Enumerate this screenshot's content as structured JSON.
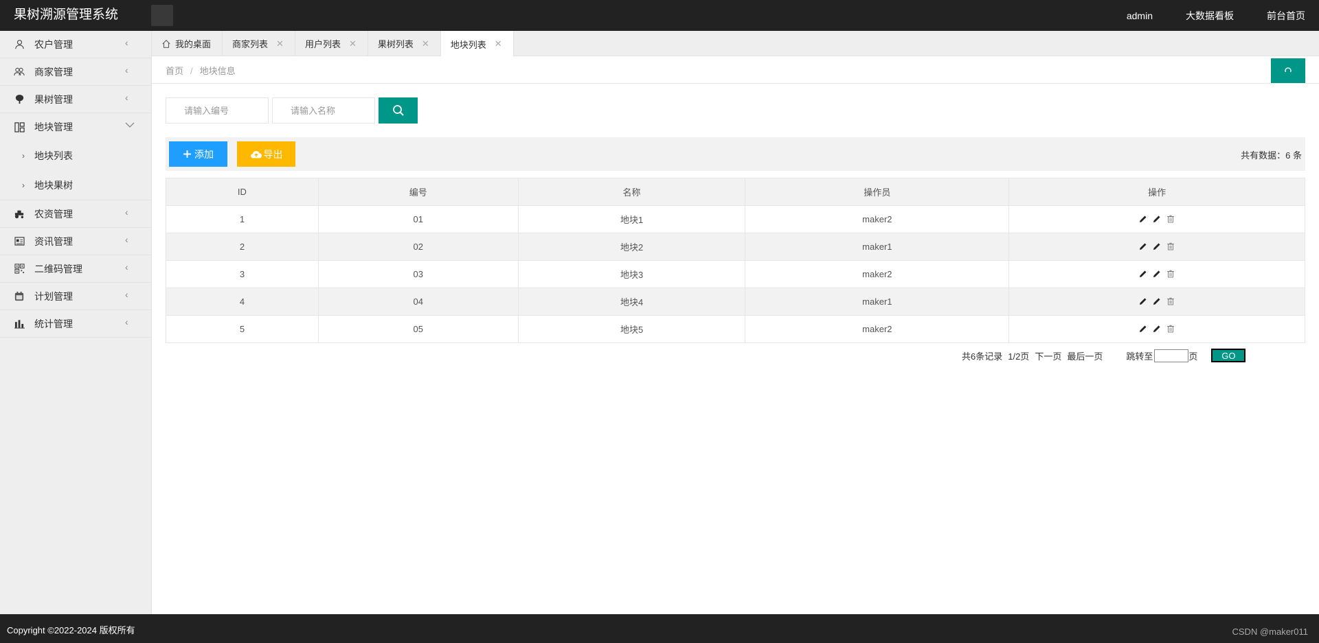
{
  "header": {
    "title": "果树溯源管理系统",
    "nav": [
      "admin",
      "大数据看板",
      "前台首页"
    ]
  },
  "sidebar": {
    "items": [
      {
        "label": "农户管理",
        "icon": "user-icon"
      },
      {
        "label": "商家管理",
        "icon": "users-icon"
      },
      {
        "label": "果树管理",
        "icon": "tree-icon"
      },
      {
        "label": "地块管理",
        "icon": "grid-icon",
        "expanded": true,
        "children": [
          {
            "label": "地块列表"
          },
          {
            "label": "地块果树"
          }
        ]
      },
      {
        "label": "农资管理",
        "icon": "tractor-icon"
      },
      {
        "label": "资讯管理",
        "icon": "news-icon"
      },
      {
        "label": "二维码管理",
        "icon": "qrcode-icon"
      },
      {
        "label": "计划管理",
        "icon": "calendar-icon"
      },
      {
        "label": "统计管理",
        "icon": "bar-chart-icon"
      }
    ]
  },
  "tabs": [
    {
      "label": "我的桌面",
      "home": true
    },
    {
      "label": "商家列表"
    },
    {
      "label": "用户列表"
    },
    {
      "label": "果树列表"
    },
    {
      "label": "地块列表",
      "active": true
    }
  ],
  "breadcrumb": {
    "home": "首页",
    "sep": "/",
    "current": "地块信息"
  },
  "search": {
    "code_placeholder": "请输入编号",
    "name_placeholder": "请输入名称"
  },
  "toolbar": {
    "add_label": "添加",
    "export_label": "导出",
    "total_text": "共有数据：6 条"
  },
  "table": {
    "headers": [
      "ID",
      "编号",
      "名称",
      "操作员",
      "操作"
    ],
    "rows": [
      {
        "id": "1",
        "code": "01",
        "name": "地块1",
        "operator": "maker2"
      },
      {
        "id": "2",
        "code": "02",
        "name": "地块2",
        "operator": "maker1"
      },
      {
        "id": "3",
        "code": "03",
        "name": "地块3",
        "operator": "maker2"
      },
      {
        "id": "4",
        "code": "04",
        "name": "地块4",
        "operator": "maker1"
      },
      {
        "id": "5",
        "code": "05",
        "name": "地块5",
        "operator": "maker2"
      }
    ]
  },
  "pagination": {
    "records": "共6条记录",
    "page": "1/2页",
    "next": "下一页",
    "last": "最后一页",
    "jump": "跳转至",
    "page_unit": "页",
    "go": "GO"
  },
  "footer": {
    "copyright": "Copyright ©2022-2024 版权所有",
    "watermark": "CSDN @maker011"
  },
  "colors": {
    "primary": "#009688",
    "blue": "#1e9fff",
    "orange": "#ffb800",
    "header": "#222222"
  }
}
